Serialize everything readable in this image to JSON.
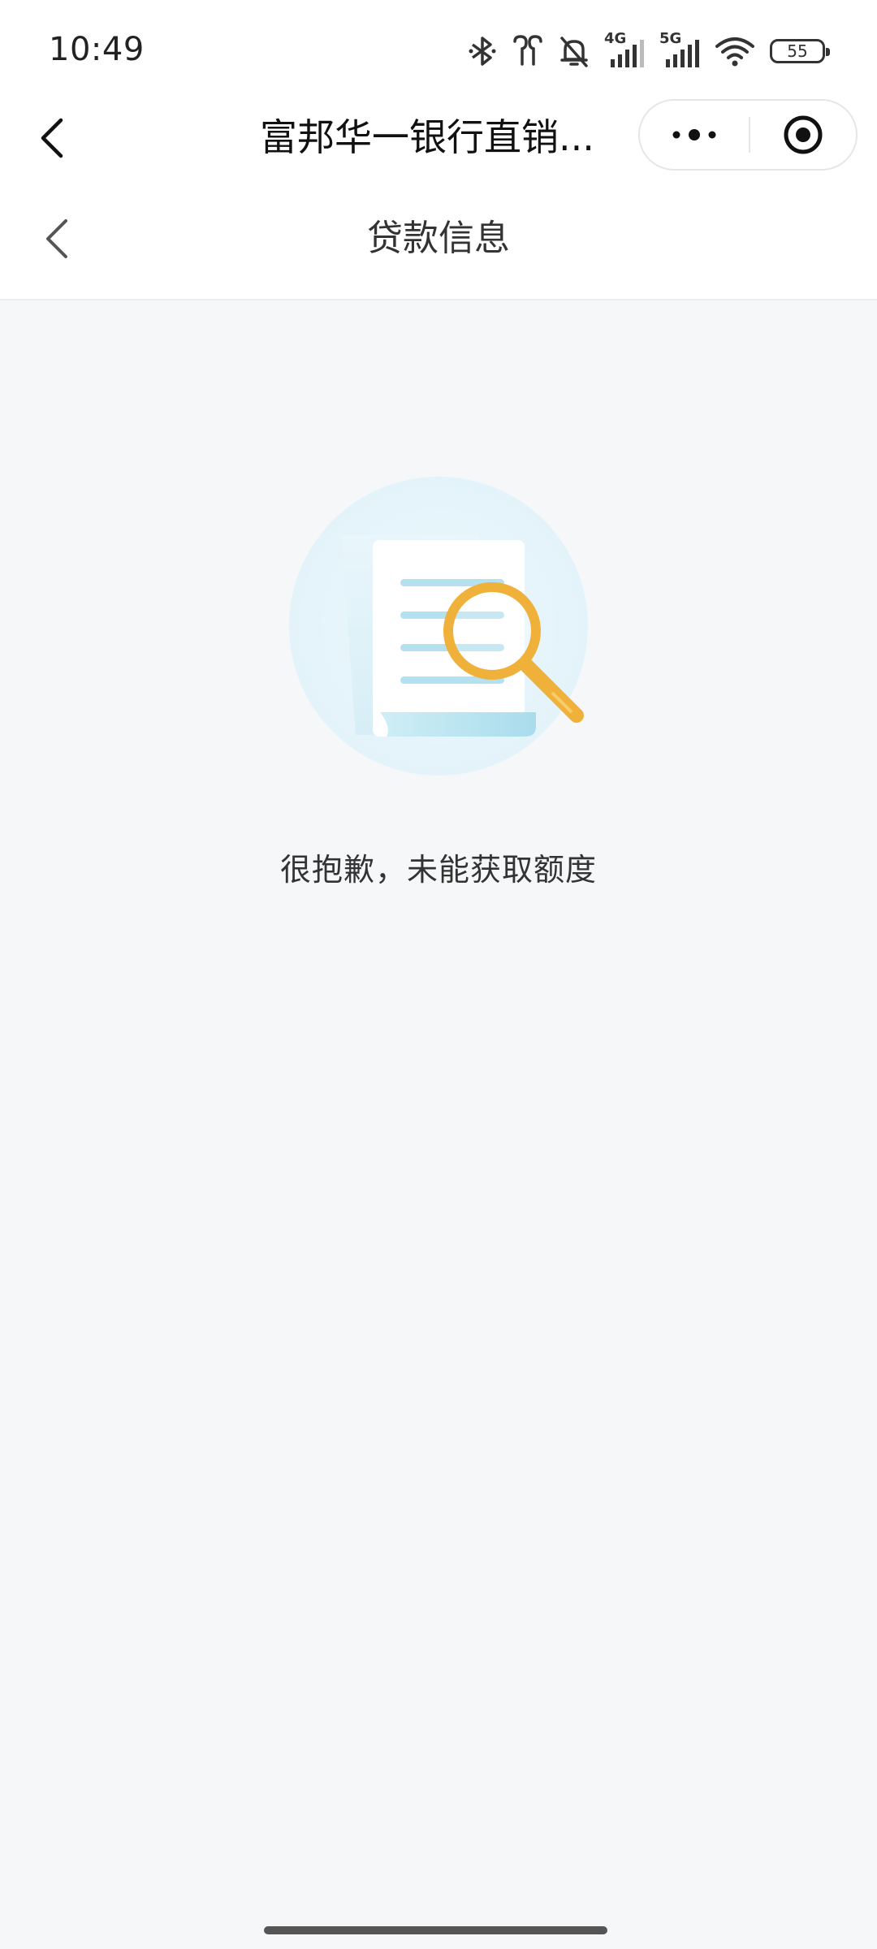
{
  "status_bar": {
    "time": "10:49",
    "network_1": "4G",
    "network_2": "5G",
    "battery_level": "55",
    "icons": [
      "bluetooth-icon",
      "earbuds-icon",
      "bell-muted-icon",
      "signal-4g-icon",
      "signal-5g-icon",
      "wifi-icon",
      "battery-icon"
    ]
  },
  "mini_program_nav": {
    "title": "富邦华一银行直销...",
    "back_icon": "chevron-left-icon",
    "more_icon": "more-dots-icon",
    "close_icon": "target-close-icon"
  },
  "page_header": {
    "title": "贷款信息",
    "back_icon": "chevron-left-icon"
  },
  "empty_state": {
    "message": "很抱歉，未能获取额度",
    "icon": "document-search-icon"
  },
  "colors": {
    "page_background": "#f6f7f9",
    "header_background": "#ffffff",
    "illustration_circle": "#e6f5fb",
    "document_lines": "#b3e1ef",
    "magnifier": "#f0b13a"
  }
}
